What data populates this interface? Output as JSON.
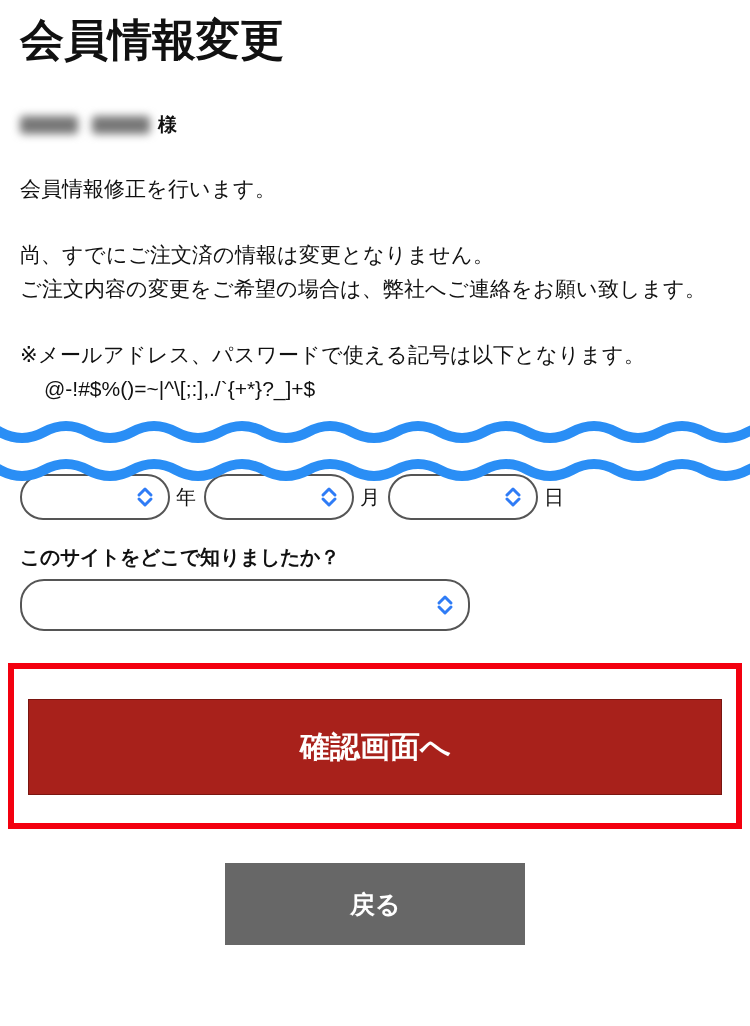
{
  "page_title": "会員情報変更",
  "greeting": {
    "honorific": "様"
  },
  "blocks": [
    {
      "lines": [
        "会員情報修正を行います。"
      ]
    },
    {
      "lines": [
        "尚、すでにご注文済の情報は変更となりません。",
        "ご注文内容の変更をご希望の場合は、弊社へご連絡をお願い致します。"
      ]
    },
    {
      "lines": [
        "※メールアドレス、パスワードで使える記号は以下となります。"
      ]
    }
  ],
  "symbols": "@-!#$%()=~|^\\[;:],./`{+*}?_]+$",
  "date_fields": [
    {
      "unit": "年"
    },
    {
      "unit": "月"
    },
    {
      "unit": "日"
    }
  ],
  "survey": {
    "label": "このサイトをどこで知りましたか？"
  },
  "confirm_button": "確認画面へ",
  "back_button": "戻る"
}
